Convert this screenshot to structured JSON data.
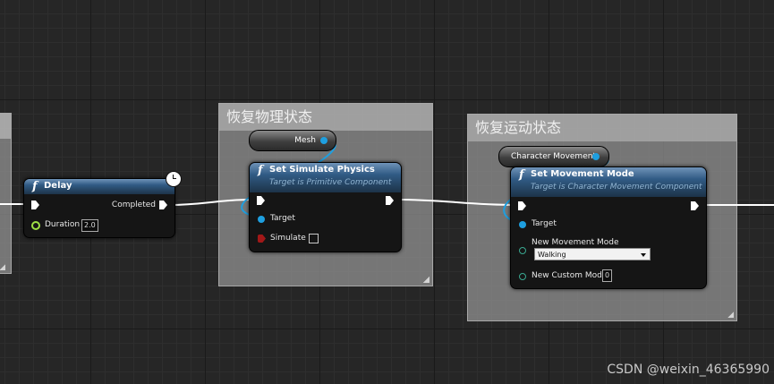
{
  "comments": [
    {
      "title": "恢复物理状态"
    },
    {
      "title": "恢复运动状态"
    }
  ],
  "delay_node": {
    "title": "Delay",
    "completed_label": "Completed",
    "duration_label": "Duration",
    "duration_value": "2.0"
  },
  "mesh_var": {
    "label": "Mesh"
  },
  "simulate_node": {
    "title": "Set Simulate Physics",
    "subtitle": "Target is Primitive Component",
    "target_label": "Target",
    "simulate_label": "Simulate"
  },
  "charmove_var": {
    "label": "Character Movement"
  },
  "movement_node": {
    "title": "Set Movement Mode",
    "subtitle": "Target is Character Movement Component",
    "target_label": "Target",
    "new_mode_label": "New Movement Mode",
    "new_mode_value": "Walking",
    "custom_mode_label": "New Custom Mode",
    "custom_mode_value": "0"
  },
  "watermark": "CSDN @weixin_46365990",
  "colors": {
    "object_pin": "#1e9fe0",
    "bool_pin": "#a21818",
    "float_pin": "#9ee045",
    "byte_pin": "#3aa890",
    "node_header": "#305a84",
    "comment_bg": "#969696"
  }
}
